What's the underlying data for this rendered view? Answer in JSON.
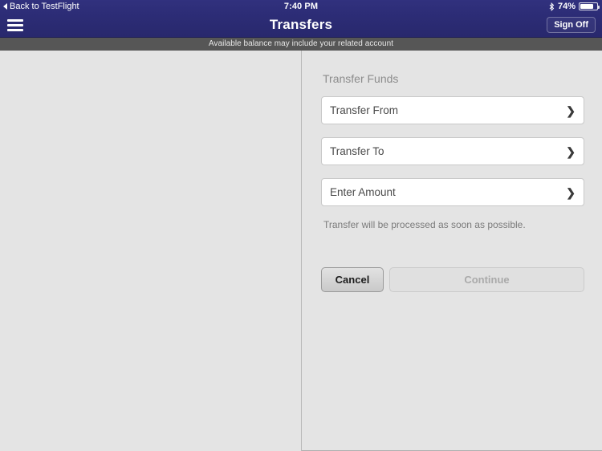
{
  "status_bar": {
    "back_label": "Back to TestFlight",
    "back_icon": "triangle-left-icon",
    "time": "7:40 PM",
    "bluetooth_icon": "bluetooth-icon",
    "battery_percent": "74%",
    "battery_level": 74
  },
  "nav_bar": {
    "menu_icon": "hamburger-menu-icon",
    "title": "Transfers",
    "sign_off_label": "Sign Off"
  },
  "notice": {
    "text": "Available balance may include your related account"
  },
  "form": {
    "section_title": "Transfer Funds",
    "fields": [
      {
        "label": "Transfer From",
        "chevron": "chevron-right-icon"
      },
      {
        "label": "Transfer To",
        "chevron": "chevron-right-icon"
      },
      {
        "label": "Enter Amount",
        "chevron": "chevron-right-icon"
      }
    ],
    "hint": "Transfer will be processed as soon as possible.",
    "cancel_label": "Cancel",
    "continue_label": "Continue"
  },
  "colors": {
    "navbar": "#2d2d77",
    "notice_bar": "#565656",
    "page_background": "#e4e4e4",
    "field_background": "#ffffff"
  }
}
